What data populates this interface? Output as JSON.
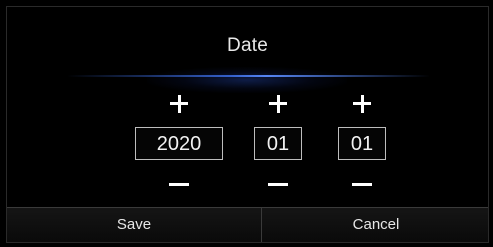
{
  "dialog": {
    "title": "Date"
  },
  "date": {
    "year": "2020",
    "month": "01",
    "day": "01"
  },
  "icons": {
    "increment": "plus-icon",
    "decrement": "minus-icon"
  },
  "buttons": {
    "save_label": "Save",
    "cancel_label": "Cancel"
  },
  "colors": {
    "background": "#000000",
    "text": "#e8e8e8",
    "accent_glow": "#3c6ee6",
    "field_border": "#bdbdbd"
  }
}
